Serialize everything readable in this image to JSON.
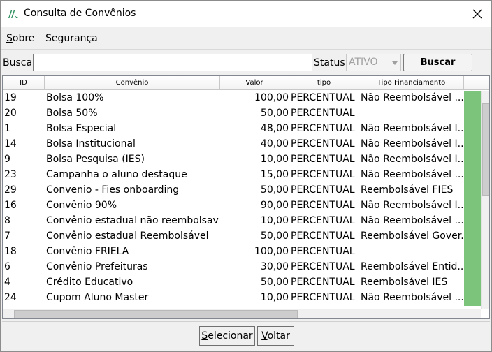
{
  "window": {
    "title": "Consulta de Convênios"
  },
  "menu": {
    "items": [
      {
        "label_u": "S",
        "label_rest": "obre"
      },
      {
        "label_u": "",
        "label_rest": "Segurança"
      }
    ]
  },
  "search": {
    "busca_label": "Busca:",
    "busca_value": "",
    "status_label": "Status:",
    "status_value": "ATIVO",
    "buscar_label": "Buscar"
  },
  "table": {
    "headers": [
      "ID",
      "Convênio",
      "Valor",
      "tipo",
      "Tipo Financiamento"
    ],
    "rows": [
      [
        "19",
        "Bolsa 100%",
        "100,00",
        "PERCENTUAL",
        "Não Reembolsável ..."
      ],
      [
        "20",
        "Bolsa 50%",
        "50,00",
        "PERCENTUAL",
        ""
      ],
      [
        "1",
        "Bolsa Especial",
        "48,00",
        "PERCENTUAL",
        "Não Reembolsável I..."
      ],
      [
        "14",
        "Bolsa Institucional",
        "40,00",
        "PERCENTUAL",
        "Não Reembolsável I..."
      ],
      [
        "9",
        "Bolsa Pesquisa (IES)",
        "10,00",
        "PERCENTUAL",
        "Não Reembolsável I..."
      ],
      [
        "23",
        "Campanha o aluno destaque",
        "15,00",
        "PERCENTUAL",
        "Não Reembolsável ..."
      ],
      [
        "29",
        "Convenio - Fies onboarding",
        "50,00",
        "PERCENTUAL",
        "Reembolsável FIES"
      ],
      [
        "16",
        "Convênio 90%",
        "90,00",
        "PERCENTUAL",
        "Não Reembolsável I..."
      ],
      [
        "8",
        "Convênio estadual não reembolsavel",
        "10,00",
        "PERCENTUAL",
        "Não Reembolsável ..."
      ],
      [
        "7",
        "Convênio estadual Reembolsável",
        "50,00",
        "PERCENTUAL",
        "Reembolsável Gover..."
      ],
      [
        "18",
        "Convênio FRIELA",
        "100,00",
        "PERCENTUAL",
        ""
      ],
      [
        "6",
        "Convênio Prefeituras",
        "30,00",
        "PERCENTUAL",
        "Reembolsável Entid..."
      ],
      [
        "4",
        "Crédito Educativo",
        "50,00",
        "PERCENTUAL",
        "Reembolsável IES"
      ],
      [
        "24",
        "Cupom Aluno Master",
        "10,00",
        "PERCENTUAL",
        "Não Reembolsável ..."
      ]
    ]
  },
  "footer": {
    "selecionar_u": "S",
    "selecionar_rest": "elecionar",
    "voltar_u": "V",
    "voltar_rest": "oltar"
  },
  "colors": {
    "status_cell": "#7cc37c",
    "border": "#828790"
  }
}
